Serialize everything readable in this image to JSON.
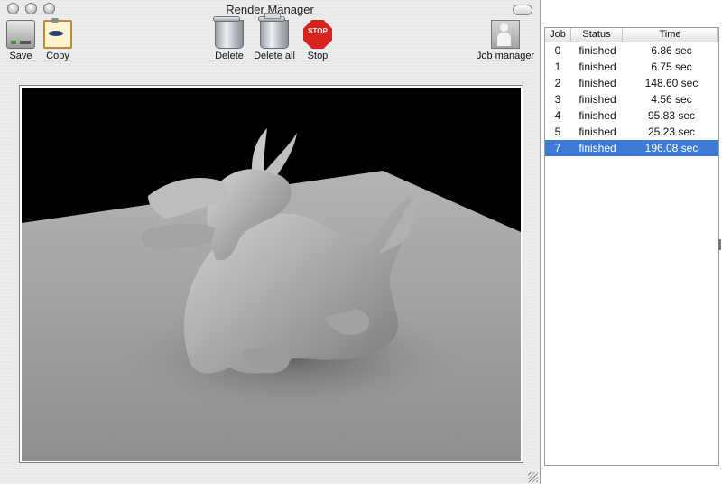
{
  "window": {
    "title": "Render Manager"
  },
  "toolbar": {
    "save": {
      "label": "Save",
      "icon": "hard-disk-icon"
    },
    "copy": {
      "label": "Copy",
      "icon": "clipboard-icon"
    },
    "delete": {
      "label": "Delete",
      "icon": "trash-can-icon"
    },
    "delete_all": {
      "label": "Delete all",
      "icon": "full-trash-can-icon"
    },
    "stop": {
      "label": "Stop",
      "icon_text": "STOP"
    },
    "job_manager": {
      "label": "Job manager",
      "icon": "person-icon"
    }
  },
  "jobs": {
    "headers": {
      "job": "Job",
      "status": "Status",
      "time": "Time"
    },
    "rows": [
      {
        "job": "0",
        "status": "finished",
        "time": "6.86 sec",
        "selected": false
      },
      {
        "job": "1",
        "status": "finished",
        "time": "6.75 sec",
        "selected": false
      },
      {
        "job": "2",
        "status": "finished",
        "time": "148.60 sec",
        "selected": false
      },
      {
        "job": "3",
        "status": "finished",
        "time": "4.56 sec",
        "selected": false
      },
      {
        "job": "4",
        "status": "finished",
        "time": "95.83 sec",
        "selected": false
      },
      {
        "job": "5",
        "status": "finished",
        "time": "25.23 sec",
        "selected": false
      },
      {
        "job": "7",
        "status": "finished",
        "time": "196.08 sec",
        "selected": true
      }
    ]
  },
  "colors": {
    "selection": "#3d7bd9",
    "stop_red": "#d6231e",
    "render_floor": "#a8a8a8"
  }
}
